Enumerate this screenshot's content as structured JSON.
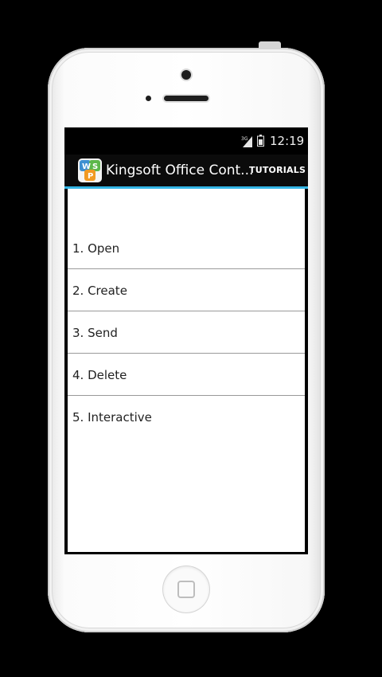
{
  "status_bar": {
    "time": "12:19",
    "network_label": "3G"
  },
  "action_bar": {
    "title": "Kingsoft Office Cont...",
    "tab_label": "TUTORIALS",
    "app_icon_letters": [
      "W",
      "S",
      "P"
    ]
  },
  "tutorials": {
    "items": [
      {
        "label": "1. Open"
      },
      {
        "label": "2. Create"
      },
      {
        "label": "3. Send"
      },
      {
        "label": "4. Delete"
      },
      {
        "label": "5. Interactive"
      }
    ]
  },
  "colors": {
    "accent": "#33b5e5",
    "action_bar": "#0b0b0b",
    "list_divider": "#9a9a9a",
    "icon_blue": "#3d8fd1",
    "icon_green": "#5cb84a",
    "icon_orange": "#f19a22"
  },
  "icons": {
    "signal": "signal-3g-icon",
    "battery": "battery-icon",
    "app": "kingsoft-office-icon",
    "home": "home-button-icon"
  }
}
